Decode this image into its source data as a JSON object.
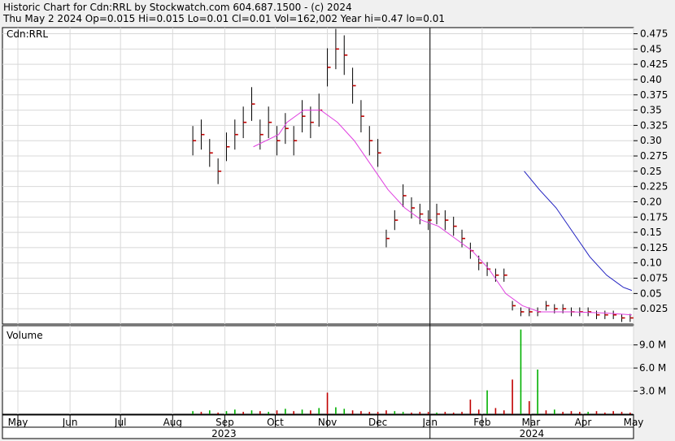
{
  "header": {
    "line1": "Historic Chart for Cdn:RRL by Stockwatch.com 604.687.1500 - (c) 2024",
    "line2": "Thu May  2 2024  Op=0.015  Hi=0.015  Lo=0.01  Cl=0.01  Vol=162,002  Year hi=0.47  lo=0.01"
  },
  "chart_data": [
    {
      "type": "ohlc",
      "title": "Cdn:RRL",
      "ylim": [
        0.0,
        0.485
      ],
      "y_ticks": [
        "0.475",
        "0.45",
        "0.425",
        "0.40",
        "0.375",
        "0.35",
        "0.325",
        "0.30",
        "0.275",
        "0.25",
        "0.225",
        "0.20",
        "0.175",
        "0.15",
        "0.125",
        "0.10",
        "0.075",
        "0.05",
        "0.025"
      ],
      "price": {
        "x": [
          104,
          109,
          114,
          119,
          124,
          129,
          134,
          139,
          144,
          149,
          154,
          159,
          164,
          169,
          174,
          179,
          184,
          189,
          194,
          199,
          204,
          209,
          214,
          219,
          224,
          229,
          234,
          239,
          244,
          249,
          254,
          259,
          264,
          269,
          274,
          279,
          284,
          289,
          294,
          299,
          304,
          309,
          314,
          319,
          324,
          329,
          334,
          339,
          344,
          349,
          354,
          359,
          364
        ],
        "y": [
          0.3,
          0.31,
          0.28,
          0.25,
          0.29,
          0.31,
          0.33,
          0.36,
          0.31,
          0.33,
          0.3,
          0.32,
          0.3,
          0.34,
          0.33,
          0.35,
          0.42,
          0.45,
          0.44,
          0.39,
          0.34,
          0.3,
          0.28,
          0.14,
          0.17,
          0.21,
          0.19,
          0.18,
          0.17,
          0.18,
          0.17,
          0.16,
          0.14,
          0.12,
          0.1,
          0.09,
          0.08,
          0.08,
          0.03,
          0.02,
          0.02,
          0.02,
          0.03,
          0.025,
          0.025,
          0.02,
          0.02,
          0.02,
          0.015,
          0.015,
          0.015,
          0.01,
          0.01
        ]
      },
      "ma_short": {
        "color": "#e040e0",
        "x": [
          140,
          155,
          160,
          170,
          180,
          190,
          200,
          210,
          220,
          230,
          240,
          250,
          260,
          270,
          280,
          290,
          300,
          310,
          330,
          350,
          365
        ],
        "y": [
          0.29,
          0.31,
          0.33,
          0.35,
          0.35,
          0.33,
          0.3,
          0.26,
          0.22,
          0.19,
          0.17,
          0.16,
          0.14,
          0.12,
          0.09,
          0.05,
          0.03,
          0.02,
          0.02,
          0.018,
          0.015
        ]
      },
      "ma_long": {
        "color": "#2020c0",
        "x": [
          301,
          310,
          320,
          330,
          340,
          350,
          360,
          365
        ],
        "y": [
          0.25,
          0.22,
          0.19,
          0.15,
          0.11,
          0.08,
          0.06,
          0.055
        ]
      }
    },
    {
      "type": "bar",
      "title": "Volume",
      "ylim": [
        0,
        11.5
      ],
      "y_ticks": [
        "9.0 M",
        "6.0 M",
        "3.0 M"
      ],
      "up_color": "#00b000",
      "down_color": "#c00000",
      "x": [
        104,
        109,
        114,
        119,
        124,
        129,
        134,
        139,
        144,
        149,
        154,
        159,
        164,
        169,
        174,
        179,
        184,
        189,
        194,
        199,
        204,
        209,
        214,
        219,
        224,
        229,
        234,
        239,
        244,
        249,
        254,
        259,
        264,
        269,
        274,
        279,
        284,
        289,
        294,
        299,
        304,
        309,
        314,
        319,
        324,
        329,
        334,
        339,
        344,
        349,
        354,
        359,
        364
      ],
      "values": [
        0.4,
        0.3,
        0.5,
        0.2,
        0.4,
        0.6,
        0.3,
        0.5,
        0.4,
        0.3,
        0.5,
        0.7,
        0.4,
        0.6,
        0.5,
        0.8,
        2.8,
        0.9,
        0.7,
        0.5,
        0.4,
        0.3,
        0.3,
        0.5,
        0.4,
        0.3,
        0.2,
        0.3,
        0.3,
        0.2,
        0.3,
        0.2,
        0.3,
        1.9,
        0.6,
        3.1,
        0.8,
        0.5,
        4.5,
        11.0,
        1.7,
        5.8,
        0.5,
        0.6,
        0.3,
        0.4,
        0.3,
        0.3,
        0.4,
        0.2,
        0.4,
        0.3,
        0.2
      ],
      "up": [
        true,
        false,
        true,
        false,
        true,
        true,
        false,
        true,
        false,
        true,
        false,
        true,
        false,
        true,
        false,
        true,
        false,
        true,
        true,
        false,
        false,
        false,
        false,
        false,
        true,
        true,
        false,
        false,
        false,
        true,
        false,
        false,
        false,
        false,
        false,
        true,
        false,
        false,
        false,
        true,
        false,
        true,
        false,
        true,
        false,
        false,
        false,
        true,
        false,
        false,
        false,
        false,
        false
      ]
    }
  ],
  "x_axis": {
    "months": [
      "May",
      "Jun",
      "Jul",
      "Aug",
      "Sep",
      "Oct",
      "Nov",
      "Dec",
      "Jan",
      "Feb",
      "Mar",
      "Apr",
      "May"
    ],
    "month_days": [
      0,
      31,
      61,
      92,
      123,
      153,
      184,
      214,
      245,
      276,
      305,
      336,
      366
    ],
    "years": [
      "2023",
      "2024"
    ],
    "year_start_days": [
      0,
      245
    ]
  }
}
